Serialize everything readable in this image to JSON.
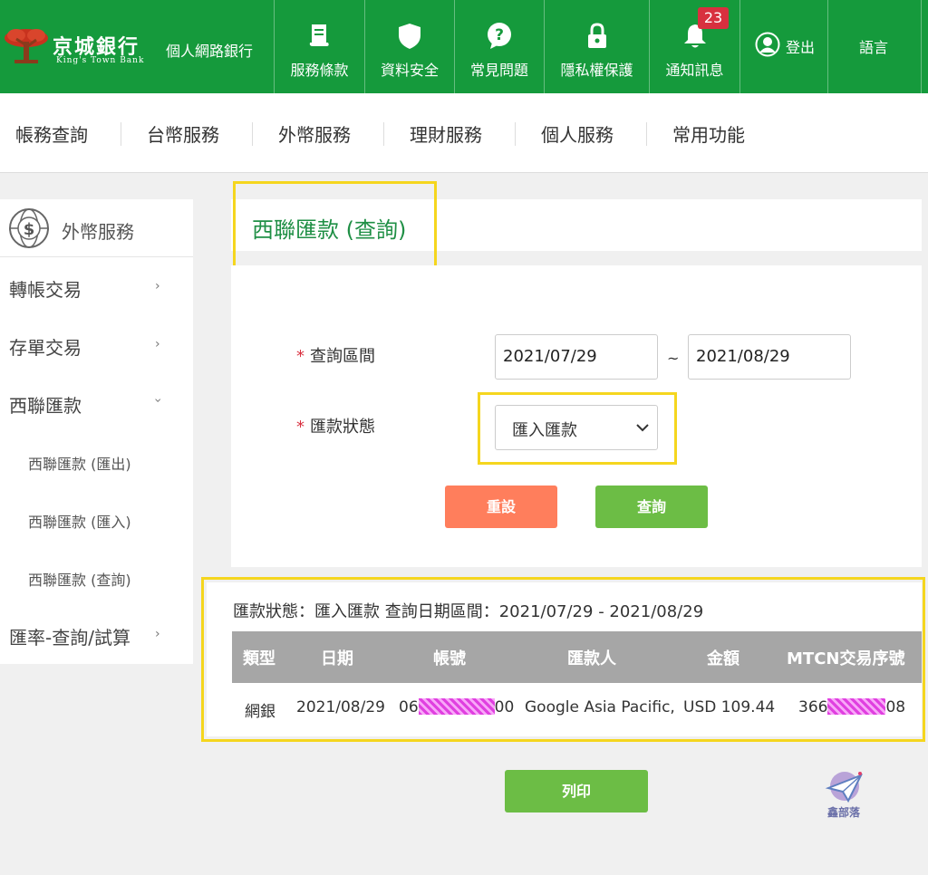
{
  "header": {
    "bank_name": "京城銀行",
    "bank_name_en": "King's Town Bank",
    "bank_sub": "個人網路銀行",
    "nav": [
      {
        "label": "服務條款",
        "icon": "document-icon"
      },
      {
        "label": "資料安全",
        "icon": "shield-icon"
      },
      {
        "label": "常見問題",
        "icon": "question-icon"
      },
      {
        "label": "隱私權保護",
        "icon": "lock-icon"
      },
      {
        "label": "通知訊息",
        "icon": "bell-icon"
      }
    ],
    "notification_count": "23",
    "logout_label": "登出",
    "language_label": "語言"
  },
  "menu": [
    "帳務查詢",
    "台幣服務",
    "外幣服務",
    "理財服務",
    "個人服務",
    "常用功能"
  ],
  "sidebar": {
    "title": "外幣服務",
    "items": [
      {
        "label": "轉帳交易",
        "arrow": "›"
      },
      {
        "label": "存單交易",
        "arrow": "›"
      },
      {
        "label": "西聯匯款",
        "arrow": "›"
      },
      {
        "label": "匯率-查詢/試算",
        "arrow": "›"
      }
    ],
    "subitems": [
      "西聯匯款 (匯出)",
      "西聯匯款 (匯入)",
      "西聯匯款 (查詢)"
    ]
  },
  "page_title": "西聯匯款 (查詢)",
  "form": {
    "date_label": "查詢區間",
    "date_from": "2021/07/29",
    "date_sep": "~",
    "date_to": "2021/08/29",
    "status_label": "匯款狀態",
    "status_value": "匯入匯款",
    "required_mark": "*",
    "reset_label": "重設",
    "query_label": "查詢"
  },
  "results": {
    "summary": "匯款狀態：匯入匯款 查詢日期區間：2021/07/29 - 2021/08/29",
    "headers": [
      "類型",
      "日期",
      "帳號",
      "匯款人",
      "金額",
      "MTCN交易序號"
    ],
    "row": {
      "type": "網銀",
      "date": "2021/08/29",
      "account_prefix": "06",
      "account_suffix": "00",
      "sender": "Google Asia Pacific,",
      "amount": "USD 109.44",
      "mtcn_prefix": "366",
      "mtcn_suffix": "08"
    }
  },
  "print_label": "列印",
  "watermark": "鑫部落",
  "colors": {
    "brand_green": "#159a3c",
    "highlight": "#f5d61e",
    "reset": "#ff7e5c",
    "action": "#6cbd45"
  }
}
